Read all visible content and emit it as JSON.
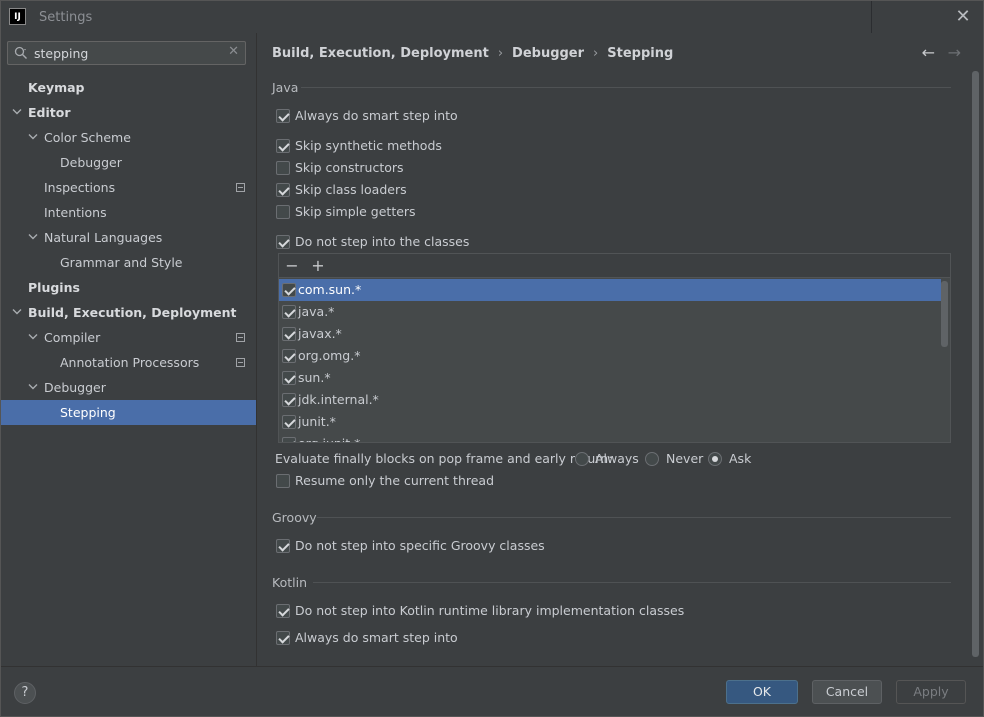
{
  "window": {
    "title": "Settings",
    "app_icon_text": "IJ"
  },
  "search": {
    "value": "stepping",
    "clear_glyph": "✕"
  },
  "sidebar": {
    "items": [
      {
        "label": "Keymap",
        "bold": true,
        "level": 0,
        "chevron": false
      },
      {
        "label": "Editor",
        "bold": true,
        "level": 0,
        "chevron": true
      },
      {
        "label": "Color Scheme",
        "bold": false,
        "level": 1,
        "chevron": true
      },
      {
        "label": "Debugger",
        "bold": false,
        "level": 2,
        "chevron": false
      },
      {
        "label": "Inspections",
        "bold": false,
        "level": 1,
        "chevron": false,
        "badge": true
      },
      {
        "label": "Intentions",
        "bold": false,
        "level": 1,
        "chevron": false
      },
      {
        "label": "Natural Languages",
        "bold": false,
        "level": 1,
        "chevron": true
      },
      {
        "label": "Grammar and Style",
        "bold": false,
        "level": 2,
        "chevron": false
      },
      {
        "label": "Plugins",
        "bold": true,
        "level": 0,
        "chevron": false
      },
      {
        "label": "Build, Execution, Deployment",
        "bold": true,
        "level": 0,
        "chevron": true
      },
      {
        "label": "Compiler",
        "bold": false,
        "level": 1,
        "chevron": true,
        "badge": true
      },
      {
        "label": "Annotation Processors",
        "bold": false,
        "level": 2,
        "chevron": false,
        "badge": true
      },
      {
        "label": "Debugger",
        "bold": false,
        "level": 1,
        "chevron": true
      },
      {
        "label": "Stepping",
        "bold": false,
        "level": 2,
        "chevron": false,
        "selected": true
      }
    ]
  },
  "breadcrumb": [
    "Build, Execution, Deployment",
    "Debugger",
    "Stepping"
  ],
  "breadcrumb_sep": "›",
  "nav": {
    "back": "←",
    "forward": "→"
  },
  "java": {
    "section_title": "Java",
    "always_smart_step": {
      "label": "Always do smart step into",
      "checked": true
    },
    "skip_synthetic": {
      "label": "Skip synthetic methods",
      "checked": true
    },
    "skip_constructors": {
      "label": "Skip constructors",
      "checked": false
    },
    "skip_class_loaders": {
      "label": "Skip class loaders",
      "checked": true
    },
    "skip_simple_getters": {
      "label": "Skip simple getters",
      "checked": false
    },
    "do_not_step_classes": {
      "label": "Do not step into the classes",
      "checked": true
    },
    "toolbar": {
      "remove": "−",
      "add": "+"
    },
    "classes": [
      {
        "name": "com.sun.*",
        "checked": true,
        "selected": true
      },
      {
        "name": "java.*",
        "checked": true
      },
      {
        "name": "javax.*",
        "checked": true
      },
      {
        "name": "org.omg.*",
        "checked": true
      },
      {
        "name": "sun.*",
        "checked": true
      },
      {
        "name": "jdk.internal.*",
        "checked": true
      },
      {
        "name": "junit.*",
        "checked": true
      },
      {
        "name": "org.junit.*",
        "checked": true
      }
    ],
    "evaluate_finally": {
      "label": "Evaluate finally blocks on pop frame and early return:",
      "options": [
        {
          "label": "Always",
          "selected": false
        },
        {
          "label": "Never",
          "selected": false
        },
        {
          "label": "Ask",
          "selected": true
        }
      ]
    },
    "resume_only_current": {
      "label": "Resume only the current thread",
      "checked": false
    }
  },
  "groovy": {
    "section_title": "Groovy",
    "do_not_step_groovy": {
      "label": "Do not step into specific Groovy classes",
      "checked": true
    }
  },
  "kotlin": {
    "section_title": "Kotlin",
    "do_not_step_kotlin_runtime": {
      "label": "Do not step into Kotlin runtime library implementation classes",
      "checked": true
    },
    "always_smart_step": {
      "label": "Always do smart step into",
      "checked": true
    }
  },
  "footer": {
    "help": "?",
    "ok": "OK",
    "cancel": "Cancel",
    "apply": "Apply"
  }
}
